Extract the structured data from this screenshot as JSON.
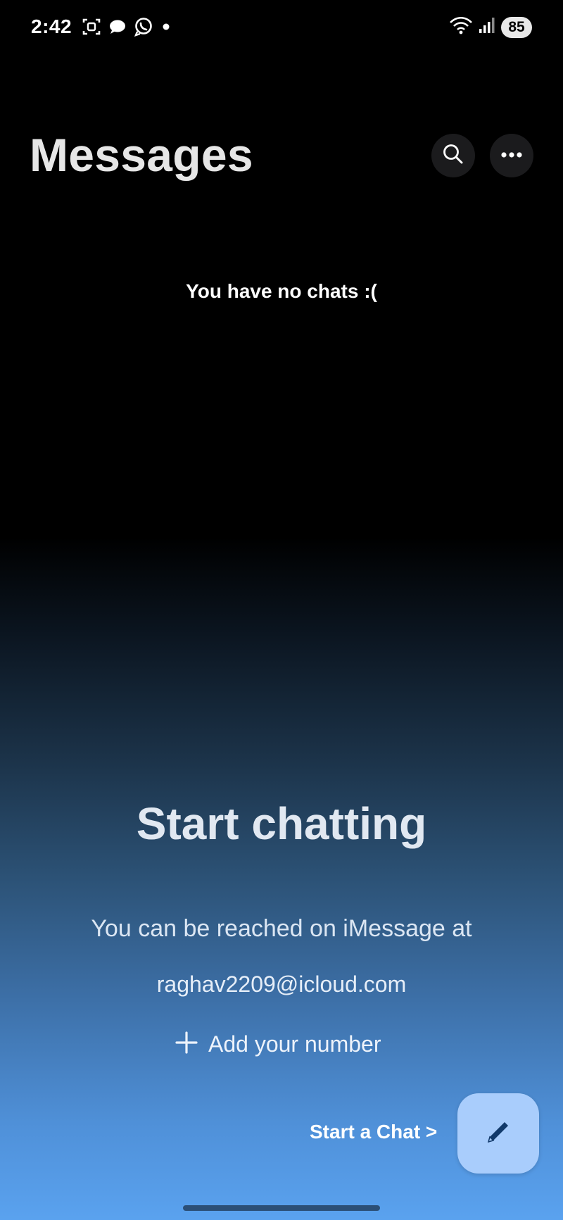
{
  "status_bar": {
    "time": "2:42",
    "battery_level": "85",
    "icons": [
      "screen-record-icon",
      "chat-bubble-icon",
      "whatsapp-icon",
      "notification-dot-icon",
      "wifi-icon",
      "signal-icon"
    ]
  },
  "header": {
    "title": "Messages",
    "search_icon": "search-icon",
    "more_icon": "more-options-icon"
  },
  "chat_list": {
    "empty_message": "You have no chats :("
  },
  "onboarding": {
    "title": "Start chatting",
    "reach_text": "You can be reached on iMessage at",
    "email": "raghav2209@icloud.com",
    "add_number_label": "Add your number",
    "start_chat_label": "Start a Chat >"
  },
  "colors": {
    "background_top": "#000000",
    "background_bottom": "#5aa2ef",
    "fab_background": "#a9cdfc",
    "fab_icon": "#123a6b"
  }
}
